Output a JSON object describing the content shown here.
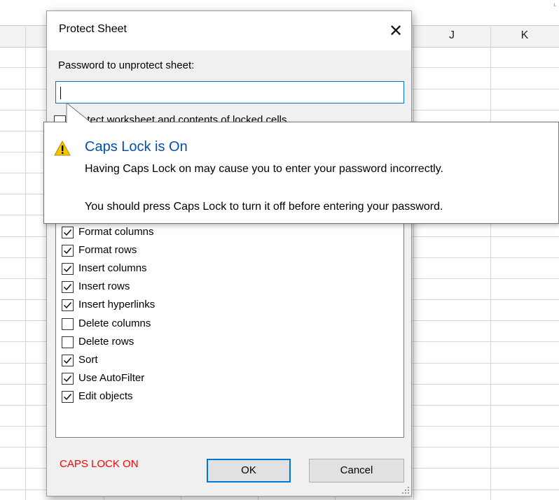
{
  "spreadsheet": {
    "columns": [
      "J",
      "K"
    ]
  },
  "dialog": {
    "title": "Protect Sheet",
    "close_glyph": "✕",
    "password_label": "Password to unprotect sheet:",
    "password_value": "",
    "protect_checkbox_label": "Protect worksheet and contents of locked cells",
    "protect_checkbox_checked": false,
    "permissions": [
      {
        "label": "Format columns",
        "checked": true
      },
      {
        "label": "Format rows",
        "checked": true
      },
      {
        "label": "Insert columns",
        "checked": true
      },
      {
        "label": "Insert rows",
        "checked": true
      },
      {
        "label": "Insert hyperlinks",
        "checked": true
      },
      {
        "label": "Delete columns",
        "checked": false
      },
      {
        "label": "Delete rows",
        "checked": false
      },
      {
        "label": "Sort",
        "checked": true
      },
      {
        "label": "Use AutoFilter",
        "checked": true
      },
      {
        "label": "Edit objects",
        "checked": true
      }
    ],
    "caps_status": "CAPS LOCK ON",
    "ok_label": "OK",
    "cancel_label": "Cancel"
  },
  "balloon": {
    "icon": "warning-icon",
    "title": "Caps Lock is On",
    "line1": "Having Caps Lock on may cause you to enter your password incorrectly.",
    "line2": "You should press Caps Lock to turn it off before entering your password."
  },
  "colors": {
    "accent": "#0078d7",
    "warning_text": "#ff0000",
    "balloon_title": "#0050b3"
  }
}
